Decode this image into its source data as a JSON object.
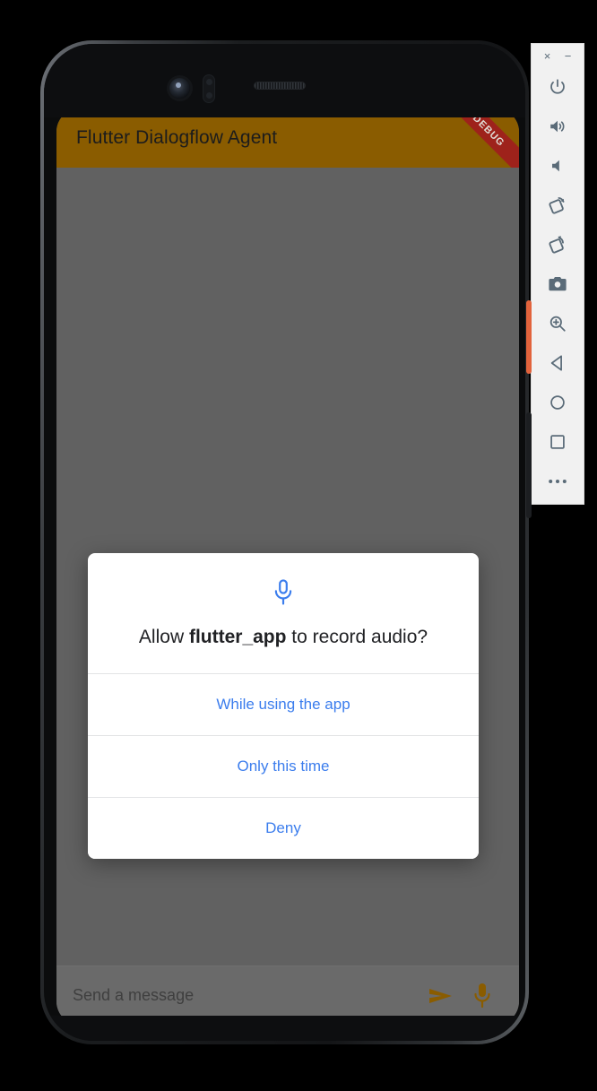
{
  "app": {
    "title": "Flutter Dialogflow Agent",
    "debug_banner": "DEBUG",
    "appbar_color": "#8a5c00",
    "accent_color": "#8a5c00",
    "scrim_color": "#616161"
  },
  "dialog": {
    "icon": "microphone-icon",
    "icon_color": "#3b7ded",
    "question_prefix": "Allow ",
    "app_name": "flutter_app",
    "question_suffix": " to record audio?",
    "options": [
      {
        "label": "While using the app",
        "name": "while-using-the-app"
      },
      {
        "label": "Only this time",
        "name": "only-this-time"
      },
      {
        "label": "Deny",
        "name": "deny"
      }
    ]
  },
  "composer": {
    "placeholder": "Send a message",
    "value": "",
    "send_icon": "send-icon",
    "mic_icon": "microphone-icon",
    "icon_color": "#8a5c00"
  },
  "emulator_toolbar": {
    "close_label": "×",
    "minimize_label": "−",
    "buttons": [
      {
        "name": "power-button",
        "label": "Power"
      },
      {
        "name": "volume-up-button",
        "label": "Volume Up"
      },
      {
        "name": "volume-down-button",
        "label": "Volume Down"
      },
      {
        "name": "rotate-left-button",
        "label": "Rotate Left"
      },
      {
        "name": "rotate-right-button",
        "label": "Rotate Right"
      },
      {
        "name": "screenshot-button",
        "label": "Take Screenshot"
      },
      {
        "name": "zoom-button",
        "label": "Enter Zoom Mode"
      },
      {
        "name": "back-button",
        "label": "Back"
      },
      {
        "name": "home-button",
        "label": "Home"
      },
      {
        "name": "overview-button",
        "label": "Overview"
      },
      {
        "name": "more-button",
        "label": "More"
      }
    ]
  }
}
